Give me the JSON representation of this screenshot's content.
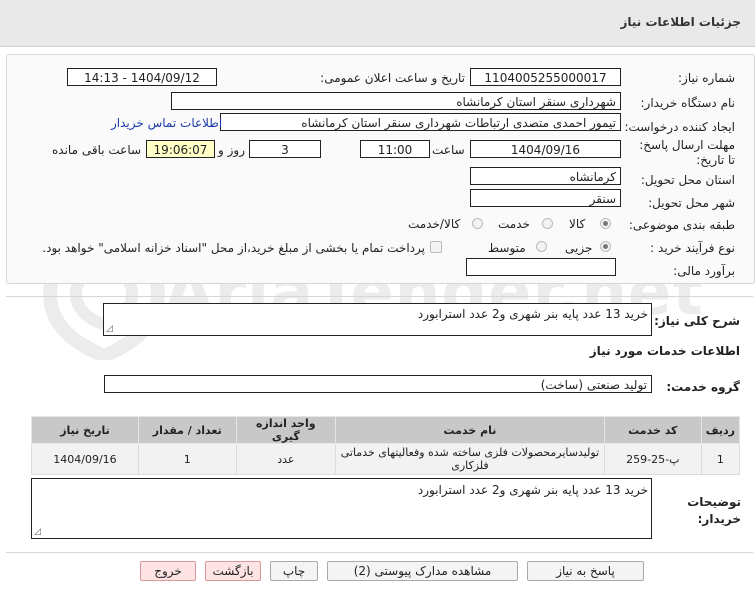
{
  "header": {
    "title": "جزئیات اطلاعات نیاز"
  },
  "watermark": {
    "text": "AriaTender.net"
  },
  "form": {
    "need_number_label": "شماره نیاز:",
    "need_number": "1104005255000017",
    "announce_label": "تاریخ و ساعت اعلان عمومی:",
    "announce_value": "1404/09/12 - 14:13",
    "buyer_org_label": "نام دستگاه خریدار:",
    "buyer_org": "شهرداری سنقر استان کرمانشاه",
    "creator_label": "ایجاد کننده درخواست:",
    "creator": "تیمور احمدی متصدی ارتباطات شهرداری سنقر استان کرمانشاه",
    "contact_link": "اطلاعات تماس خریدار",
    "deadline_label": "مهلت ارسال پاسخ: تا تاریخ:",
    "deadline_date": "1404/09/16",
    "time_label": "ساعت",
    "deadline_time": "11:00",
    "days_value": "3",
    "days_label": "روز و",
    "remaining_time": "19:06:07",
    "remaining_label": "ساعت باقی مانده",
    "province_label": "استان محل تحویل:",
    "province": "کرمانشاه",
    "city_label": "شهر محل تحویل:",
    "city": "سنقر",
    "category_label": "طبقه بندی موضوعی:",
    "category_options": [
      "کالا",
      "خدمت",
      "کالا/خدمت"
    ],
    "purchase_type_label": "نوع فرآیند خرید :",
    "purchase_type_options": [
      "جزیی",
      "متوسط"
    ],
    "payment_note": "پرداخت تمام یا بخشی از مبلغ خرید،از محل \"اسناد خزانه اسلامی\" خواهد بود.",
    "estimate_label": "برآورد مالی:",
    "estimate_value": ""
  },
  "summary": {
    "label": "شرح کلی نیاز:",
    "text": "خرید 13 عدد پایه بنر شهری و2 عدد استرابورد"
  },
  "services_section": {
    "title": "اطلاعات خدمات مورد نیاز",
    "group_label": "گروه خدمت:",
    "group_value": "تولید صنعتی (ساخت)"
  },
  "table": {
    "headers": [
      "ردیف",
      "کد خدمت",
      "نام خدمت",
      "واحد اندازه گیری",
      "تعداد / مقدار",
      "تاریخ نیاز"
    ],
    "rows": [
      [
        "1",
        "پ-25-259",
        "تولیدسایرمحصولات فلزی ساخته شده وفعالیتهای خدماتی فلزکاری",
        "عدد",
        "1",
        "1404/09/16"
      ]
    ]
  },
  "notes": {
    "label": "توضیحات خریدار:",
    "text": "خرید 13 عدد پایه بنر شهری و2 عدد استرابورد"
  },
  "buttons": {
    "reply": "پاسخ به نیاز",
    "attachments": "مشاهده مدارک پیوستی (2)",
    "print": "چاپ",
    "back": "بازگشت",
    "exit": "خروج"
  }
}
